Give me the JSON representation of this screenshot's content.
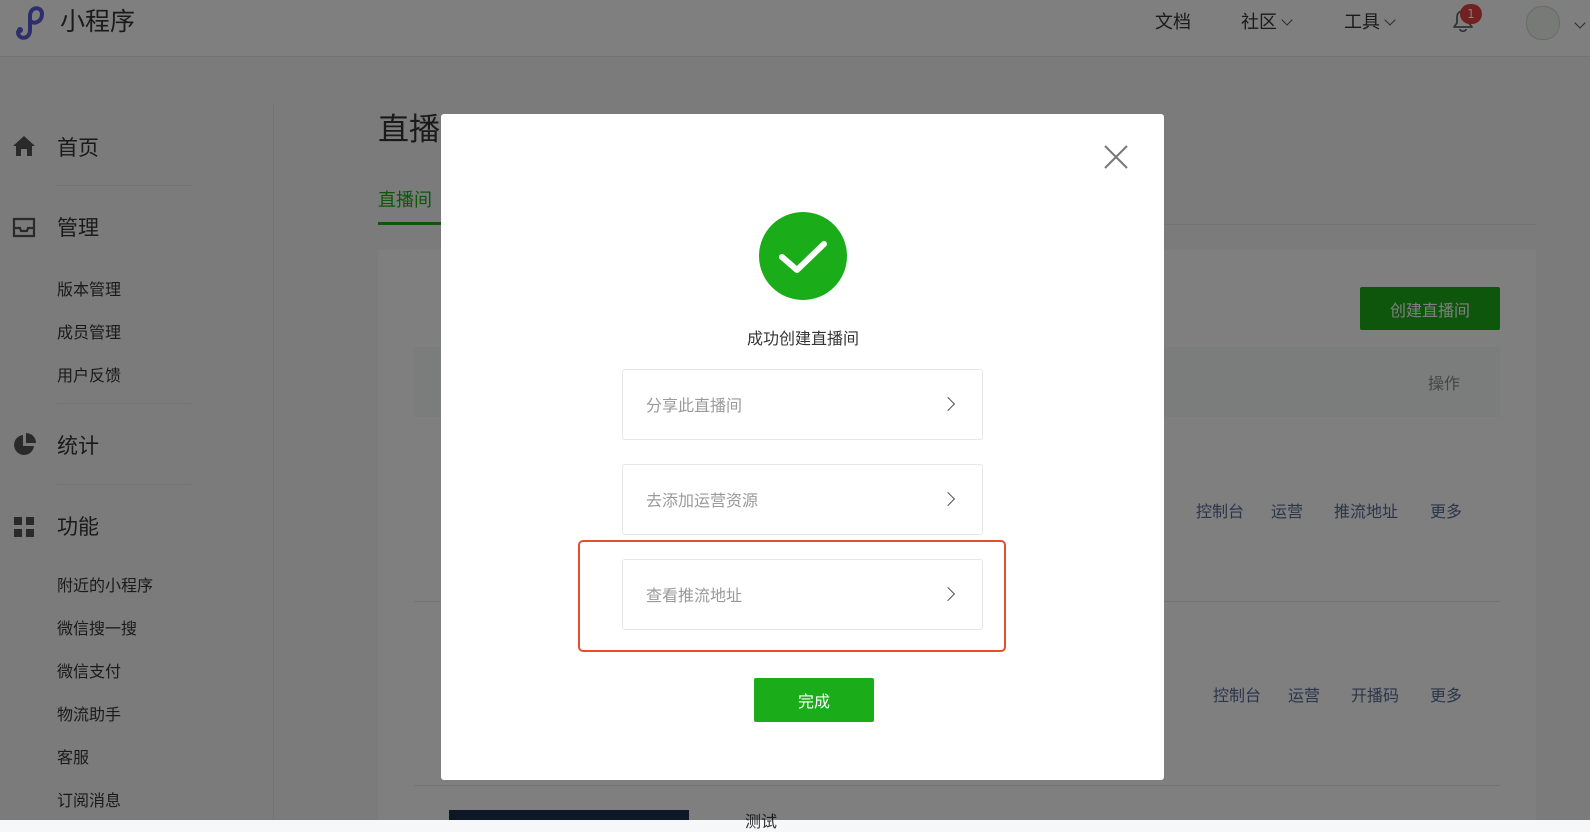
{
  "header": {
    "app_name": "小程序",
    "nav": [
      {
        "label": "文档",
        "has_dropdown": false
      },
      {
        "label": "社区",
        "has_dropdown": true
      },
      {
        "label": "工具",
        "has_dropdown": true
      }
    ],
    "notification_count": "1",
    "icons": {
      "logo": "miniprogram-logo-icon",
      "bell": "bell-icon",
      "avatar": "user-avatar"
    }
  },
  "sidebar": {
    "sections": [
      {
        "label": "首页",
        "icon": "home-icon",
        "items": []
      },
      {
        "label": "管理",
        "icon": "inbox-icon",
        "items": [
          "版本管理",
          "成员管理",
          "用户反馈"
        ]
      },
      {
        "label": "统计",
        "icon": "pie-chart-icon",
        "items": []
      },
      {
        "label": "功能",
        "icon": "grid-icon",
        "items": [
          "附近的小程序",
          "微信搜一搜",
          "微信支付",
          "物流助手",
          "客服",
          "订阅消息"
        ]
      }
    ]
  },
  "main": {
    "title": "直播",
    "active_tab": "直播间",
    "create_button": "创建直播间",
    "table_header_op": "操作",
    "rows": [
      {
        "actions": [
          "控制台",
          "运营",
          "推流地址",
          "更多"
        ]
      },
      {
        "actions": [
          "控制台",
          "运营",
          "开播码",
          "更多"
        ]
      },
      {
        "title_partial": "测试"
      }
    ]
  },
  "dialog": {
    "message": "成功创建直播间",
    "options": [
      "分享此直播间",
      "去添加运营资源",
      "查看推流地址"
    ],
    "highlighted_option": "查看推流地址",
    "done_button": "完成"
  },
  "colors": {
    "brand_green": "#1aad19",
    "link_blue": "#576b95",
    "highlight_red": "#e64f2e",
    "badge_red": "#e64340"
  }
}
